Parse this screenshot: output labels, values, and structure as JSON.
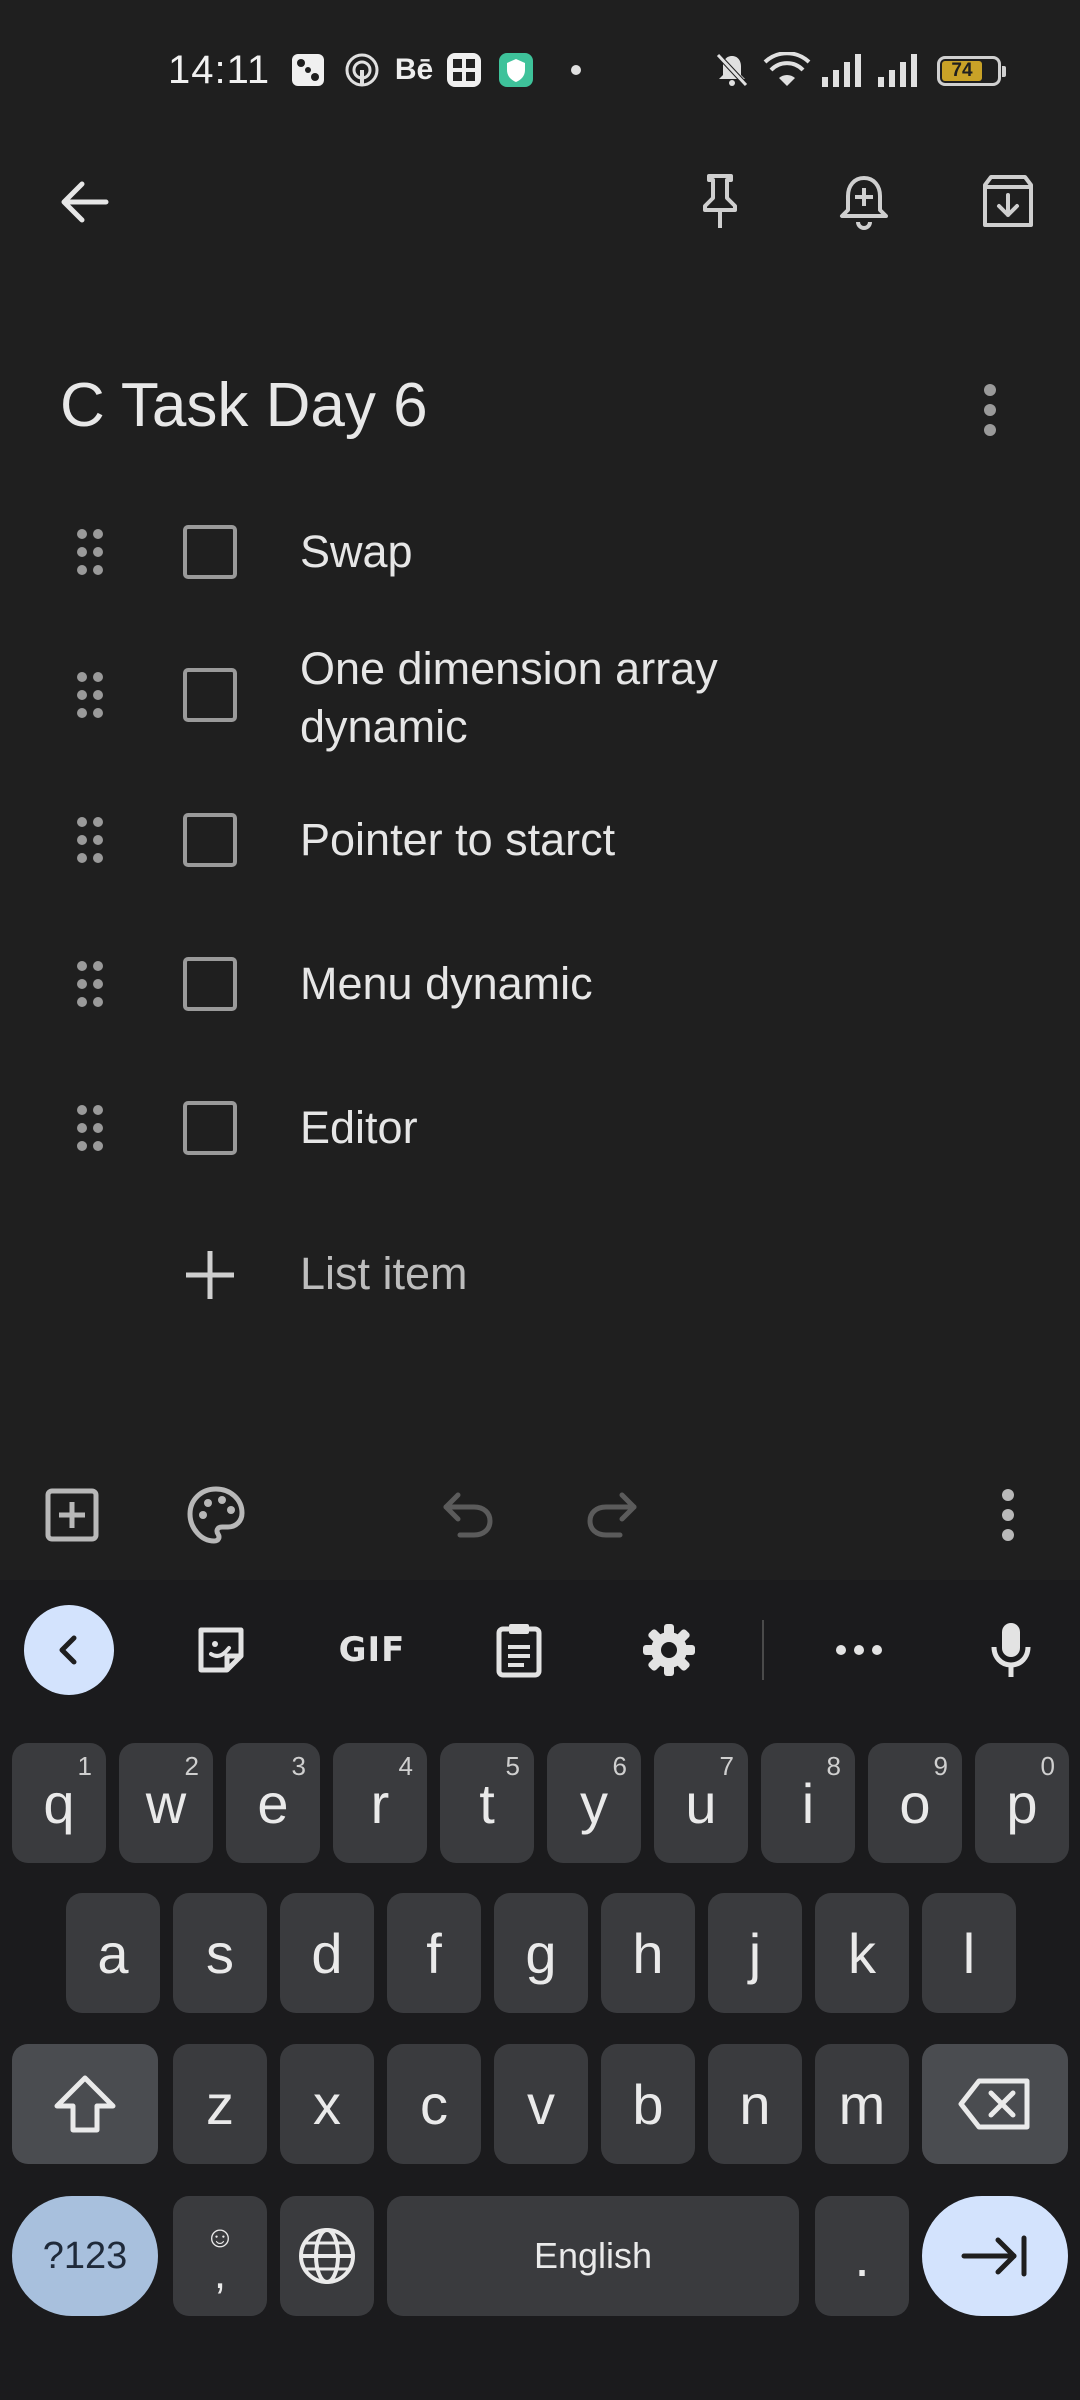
{
  "status_bar": {
    "time": "14:11",
    "battery_level": "74",
    "battery_color": "#c9a227",
    "notification_icons": [
      "dice-icon",
      "broadcast-icon",
      "behance-icon",
      "grid-app-icon",
      "shield-app-icon",
      "dot-icon"
    ],
    "system_icons": [
      "mute-bell-icon",
      "wifi-icon",
      "signal-icon",
      "signal-icon"
    ]
  },
  "top_bar": {
    "icons": [
      "back-arrow-icon",
      "pin-icon",
      "add-reminder-icon",
      "archive-icon"
    ]
  },
  "note": {
    "title": "C Task Day 6",
    "items": [
      {
        "text": "Swap",
        "checked": false
      },
      {
        "text": "One dimension array dynamic",
        "checked": false
      },
      {
        "text": "Pointer to starct",
        "checked": false
      },
      {
        "text": "Menu dynamic",
        "checked": false
      },
      {
        "text": "Editor",
        "checked": false
      }
    ],
    "add_item_label": "List item"
  },
  "bottom_toolbar": {
    "icons": [
      "add-box-icon",
      "palette-icon",
      "undo-icon",
      "redo-icon",
      "more-vert-icon"
    ]
  },
  "keyboard": {
    "toolbar_icons": [
      "collapse-icon",
      "sticker-icon",
      "gif-icon",
      "clipboard-icon",
      "settings-icon",
      "more-icon",
      "mic-icon"
    ],
    "gif_label": "GIF",
    "row1": [
      {
        "key": "q",
        "hint": "1"
      },
      {
        "key": "w",
        "hint": "2"
      },
      {
        "key": "e",
        "hint": "3"
      },
      {
        "key": "r",
        "hint": "4"
      },
      {
        "key": "t",
        "hint": "5"
      },
      {
        "key": "y",
        "hint": "6"
      },
      {
        "key": "u",
        "hint": "7"
      },
      {
        "key": "i",
        "hint": "8"
      },
      {
        "key": "o",
        "hint": "9"
      },
      {
        "key": "p",
        "hint": "0"
      }
    ],
    "row2": [
      "a",
      "s",
      "d",
      "f",
      "g",
      "h",
      "j",
      "k",
      "l"
    ],
    "row3": [
      "z",
      "x",
      "c",
      "v",
      "b",
      "n",
      "m"
    ],
    "sym_label": "?123",
    "comma_label": ",",
    "emoji_glyph": "☺",
    "space_label": "English",
    "period_label": ".",
    "accent_color": "#d3e3fd"
  }
}
